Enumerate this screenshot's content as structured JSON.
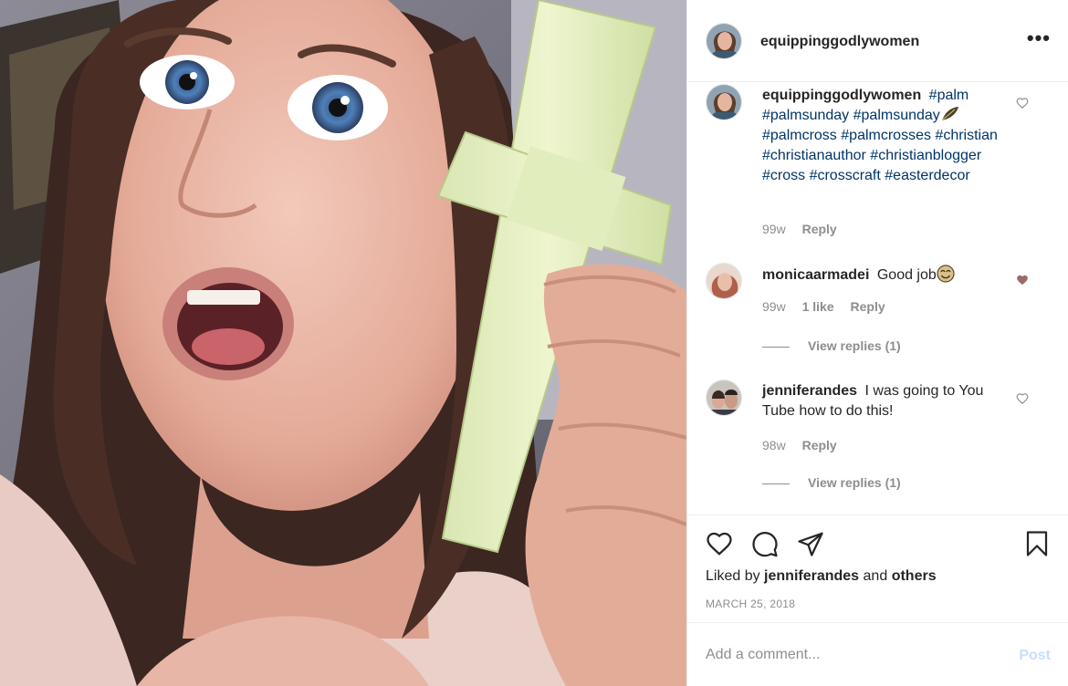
{
  "post": {
    "author": "equippinggodlywomen",
    "more_icon": "ellipsis-icon",
    "photo_alt": "Woman with surprised face holding a palm cross"
  },
  "comments": [
    {
      "username": "equippinggodlywomen",
      "text_parts": [
        "#palm",
        "#palmsunday",
        "#palmsunday",
        "#palmcross",
        "#palmcrosses",
        "#christian",
        "#christianauthor",
        "#christianblogger",
        "#cross",
        "#crosscraft",
        "#easterdecor"
      ],
      "emoji": "leaf-emoji",
      "age": "99w",
      "reply_label": "Reply",
      "liked": false
    },
    {
      "username": "monicaarmadei",
      "text": "Good job",
      "emoji": "smile-emoji",
      "age": "99w",
      "likes": "1 like",
      "reply_label": "Reply",
      "view_replies": "View replies (1)",
      "liked": true
    },
    {
      "username": "jenniferandes",
      "text": "I was going to You Tube how to do this!",
      "age": "98w",
      "reply_label": "Reply",
      "view_replies": "View replies (1)",
      "liked": false
    }
  ],
  "actions": {
    "like_icon": "heart-icon",
    "comment_icon": "comment-icon",
    "share_icon": "share-icon",
    "save_icon": "bookmark-icon"
  },
  "likes": {
    "prefix": "Liked by",
    "user": "jenniferandes",
    "and": "and",
    "others": "others"
  },
  "date": "MARCH 25, 2018",
  "add_comment": {
    "placeholder": "Add a comment...",
    "post_label": "Post"
  },
  "colors": {
    "hashtag": "#003569",
    "muted": "#8e8e8e",
    "liked_heart": "#9b6b6b",
    "post_disabled": "#c7dffa"
  }
}
